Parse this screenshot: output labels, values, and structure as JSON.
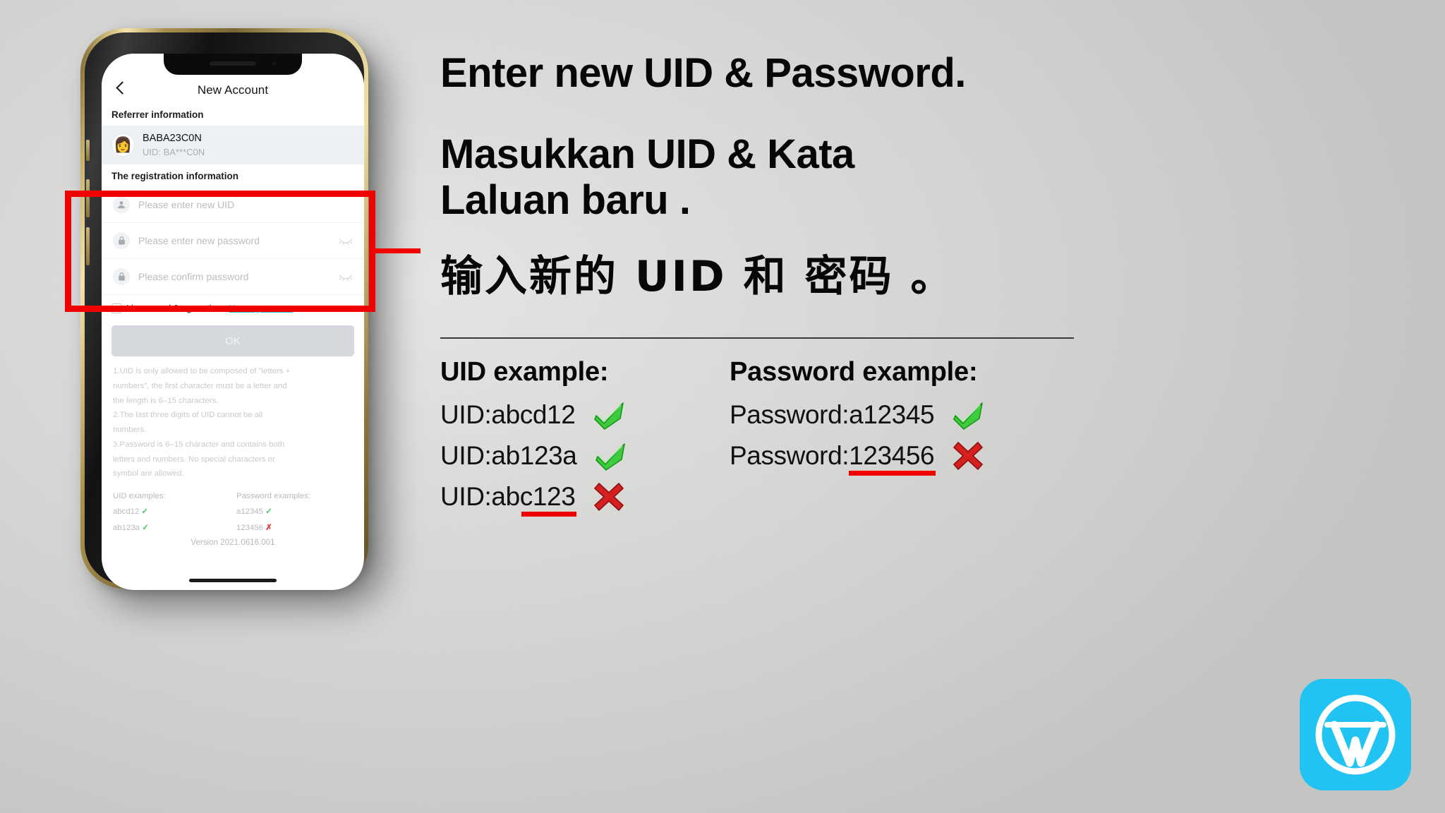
{
  "phone": {
    "nav": {
      "back_icon": "chevron-left-icon",
      "title": "New Account"
    },
    "referrer": {
      "section_label": "Referrer information",
      "avatar_icon": "avatar-icon",
      "name": "BABA23C0N",
      "uid": "UID:  BA***C0N"
    },
    "registration": {
      "section_label": "The registration information",
      "fields": [
        {
          "icon": "user-icon",
          "placeholder": "Please enter new UID",
          "value": "",
          "toggle": null
        },
        {
          "icon": "lock-icon",
          "placeholder": "Please enter new password",
          "value": "",
          "toggle": "eye-off-icon"
        },
        {
          "icon": "lock-icon",
          "placeholder": "Please confirm password",
          "value": "",
          "toggle": "eye-off-icon"
        }
      ]
    },
    "agreement": {
      "checkbox_checked": false,
      "text": "I have read & agree the",
      "link": "User agreement"
    },
    "submit_label": "OK",
    "rules": [
      "1.UID is only allowed to be composed of \"letters +",
      "numbers\", the first character must be a letter and",
      "the length is 6–15 characters.",
      "2.The last three digits of UID cannot be all",
      "numbers.",
      "3.Password is 6–15 character and contains both",
      "letters and numbers. No special characters or",
      "symbol are allowed."
    ],
    "examples": {
      "uid_header": "UID examples:",
      "password_header": "Password examples:",
      "uid_rows": [
        {
          "value": "abcd12",
          "mark": "check"
        },
        {
          "value": "ab123a",
          "mark": "check"
        }
      ],
      "password_rows": [
        {
          "value": "a12345",
          "mark": "check"
        },
        {
          "value": "123456",
          "mark": "cross"
        }
      ]
    },
    "version": "Version 2021.0616.001"
  },
  "callout": {
    "box_name": "red-highlight-box",
    "pointer_name": "red-pointer-line",
    "color": "#f20000"
  },
  "right": {
    "heading_en": "Enter new UID & Password.",
    "heading_ms_line1": "Masukkan UID & Kata",
    "heading_ms_line2": "Laluan baru .",
    "heading_zh": "输入新的 UID 和 密码 。",
    "uid_examples": {
      "header": "UID example:",
      "rows": [
        {
          "label": "UID: ",
          "value": "abcd12",
          "mark": "check",
          "underline": "none"
        },
        {
          "label": "UID: ",
          "value": "ab123a",
          "mark": "check",
          "underline": "none"
        },
        {
          "label": "UID: ",
          "value": "abc123",
          "mark": "cross",
          "underline": "partial"
        }
      ]
    },
    "password_examples": {
      "header": "Password example:",
      "rows": [
        {
          "label": "Password: ",
          "value": "a12345",
          "mark": "check",
          "underline": "none"
        },
        {
          "label": "Password: ",
          "value": "123456",
          "mark": "cross",
          "underline": "full"
        }
      ]
    }
  },
  "brand": {
    "logo_icon": "w-circle-logo-icon",
    "logo_letter": "W",
    "logo_bg": "#21c3f3"
  }
}
